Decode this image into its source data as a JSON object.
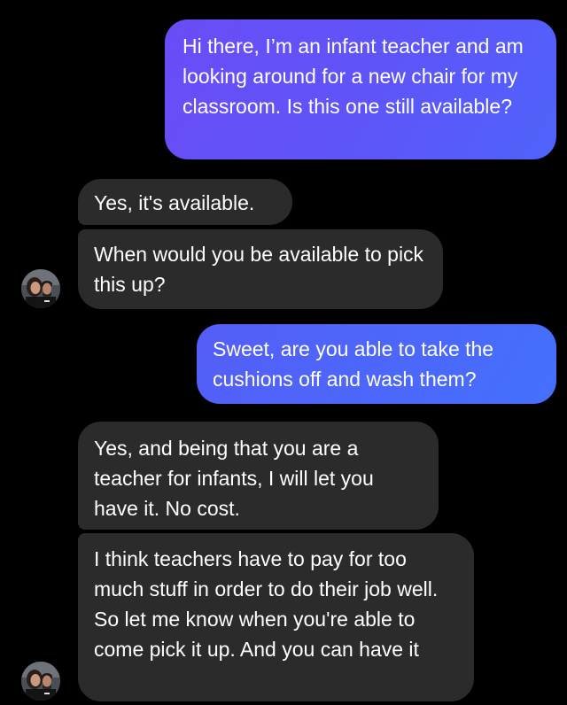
{
  "conversation": {
    "messages": [
      {
        "sender": "me",
        "text": "Hi there, I’m an infant teacher and am looking around for a new chair for my classroom. Is this one still available?"
      },
      {
        "sender": "them",
        "text": "Yes, it's available."
      },
      {
        "sender": "them",
        "text": "When would you be available to pick this up?"
      },
      {
        "sender": "me",
        "text": "Sweet, are you able to take the cushions off and wash them?"
      },
      {
        "sender": "them",
        "text": "Yes, and being that you are a teacher for infants, I will let you have it. No cost."
      },
      {
        "sender": "them",
        "text": "I think teachers have to pay for too much stuff in order to do their job well. So let me know when you're able to come pick it up. And you can have it"
      }
    ]
  },
  "colors": {
    "background": "#000000",
    "sent_bubble_start": "#6a4cf6",
    "sent_bubble_end": "#4f63fb",
    "received_bubble": "#2b2b2b",
    "text": "#ffffff"
  },
  "icons": {
    "contact_avatar": "contact-avatar-photo"
  }
}
